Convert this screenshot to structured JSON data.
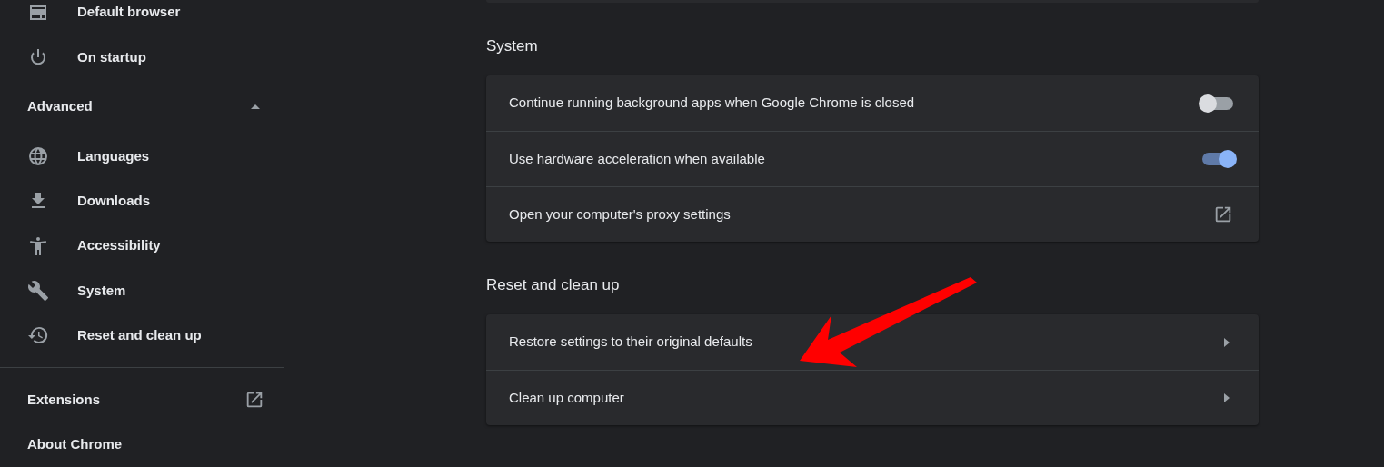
{
  "sidebar": {
    "items": [
      {
        "label": "Default browser"
      },
      {
        "label": "On startup"
      }
    ],
    "advanced": {
      "label": "Advanced",
      "expanded": true
    },
    "advanced_items": [
      {
        "label": "Languages"
      },
      {
        "label": "Downloads"
      },
      {
        "label": "Accessibility"
      },
      {
        "label": "System"
      },
      {
        "label": "Reset and clean up"
      }
    ],
    "links": [
      {
        "label": "Extensions",
        "kind": "external"
      },
      {
        "label": "About Chrome",
        "kind": "plain"
      }
    ]
  },
  "sections": [
    {
      "title": "System",
      "rows": [
        {
          "label": "Continue running background apps when Google Chrome is closed",
          "kind": "toggle",
          "on": false
        },
        {
          "label": "Use hardware acceleration when available",
          "kind": "toggle",
          "on": true
        },
        {
          "label": "Open your computer's proxy settings",
          "kind": "external"
        }
      ]
    },
    {
      "title": "Reset and clean up",
      "rows": [
        {
          "label": "Restore settings to their original defaults",
          "kind": "arrow"
        },
        {
          "label": "Clean up computer",
          "kind": "arrow"
        }
      ]
    }
  ]
}
